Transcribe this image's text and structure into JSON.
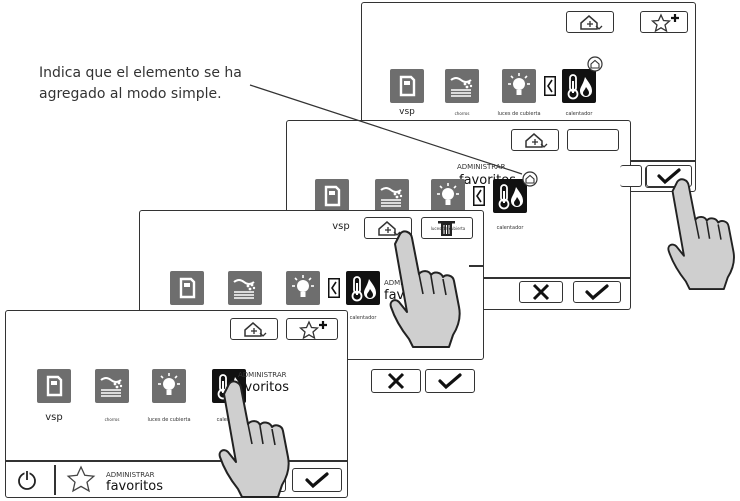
{
  "callout": {
    "line1": "Indica que el elemento se ha",
    "line2": "agregado al modo simple."
  },
  "tiles": {
    "vsp": "vsp",
    "chorros": "chorros",
    "lights": "luces de cubierta",
    "heater": "calentador"
  },
  "manage": {
    "line1": "ADMINISTRAR",
    "line2": "favoritos"
  },
  "icons": {
    "home_add": "home-add-icon",
    "star_add": "star-add-icon",
    "trash": "trash-icon",
    "check": "check-icon",
    "close": "close-icon",
    "power": "power-icon",
    "star": "star-icon",
    "pump": "pump-icon",
    "jets": "jets-icon",
    "bulb": "lightbulb-icon",
    "thermo": "thermometer-flame-icon",
    "hand": "pointing-hand-icon",
    "chevron": "chevron-left-icon",
    "simple_badge": "simple-mode-badge-icon"
  },
  "colors": {
    "tile_gray": "#6e6e6e",
    "tile_dark": "#111111",
    "hand_fill": "#cfcfcf",
    "stroke": "#333333"
  }
}
